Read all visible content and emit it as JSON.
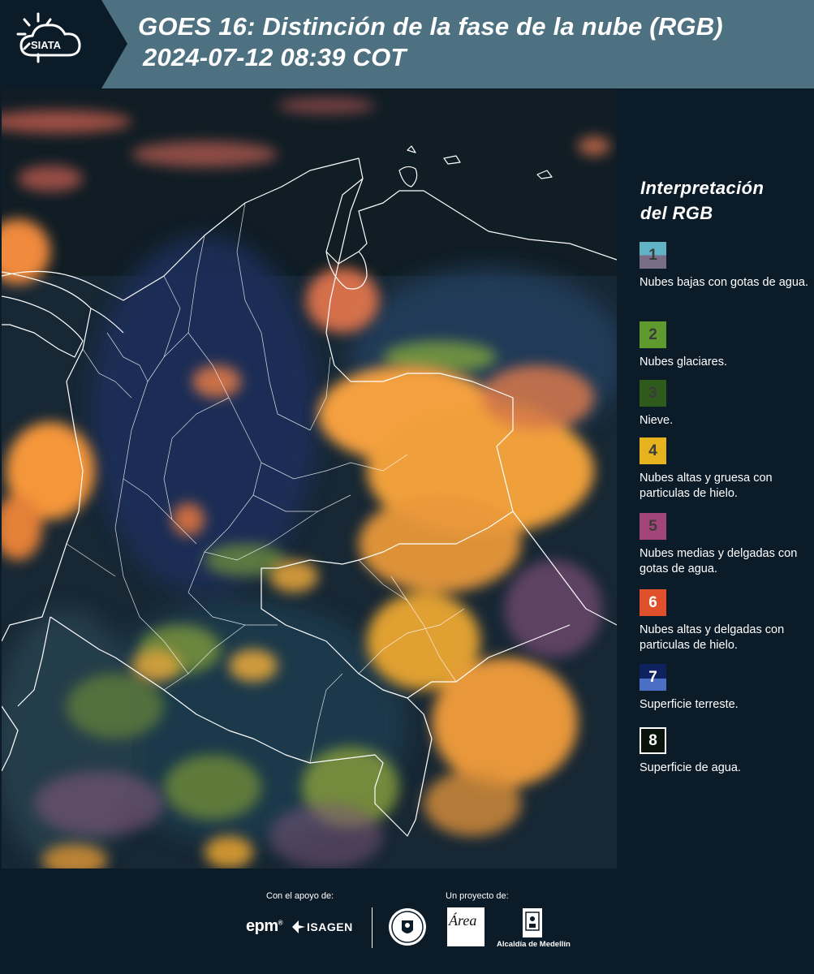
{
  "header": {
    "logo_text": "SIATA",
    "title_line1": "GOES 16: Distinción de la fase de la nube (RGB)",
    "title_line2": "2024-07-12 08:39 COT"
  },
  "legend": {
    "title_line1": "Interpretación",
    "title_line2": "del RGB",
    "items": [
      {
        "number": "1",
        "label": "Nubes bajas con gotas de agua.",
        "color_top": "#5fb3c4",
        "color_bottom": "#7a6d86"
      },
      {
        "number": "2",
        "label": "Nubes glaciares.",
        "color_top": "#5e9a2e",
        "color_bottom": "#5e9a2e"
      },
      {
        "number": "3",
        "label": "Nieve.",
        "color_top": "#2e5a1c",
        "color_bottom": "#2e5a1c"
      },
      {
        "number": "4",
        "label": "Nubes altas y gruesa con particulas de hielo.",
        "color_top": "#e6b21e",
        "color_bottom": "#e6b21e"
      },
      {
        "number": "5",
        "label": "Nubes medias y delgadas con gotas de agua.",
        "color_top": "#a3457a",
        "color_bottom": "#a3457a"
      },
      {
        "number": "6",
        "label": "Nubes altas y delgadas con particulas de hielo.",
        "color_top": "#e0502a",
        "color_bottom": "#e0502a"
      },
      {
        "number": "7",
        "label": "Superficie terreste.",
        "color_top": "#0f2260",
        "color_bottom": "#4b6fc4"
      },
      {
        "number": "8",
        "label": "Superficie de agua.",
        "color_top": "#0a140a",
        "color_bottom": "#0a140a"
      }
    ]
  },
  "footer": {
    "support_label": "Con el apoyo de:",
    "project_label": "Un proyecto de:",
    "sponsor1": "epm",
    "sponsor2": "ISAGEN",
    "partner_area": "Área",
    "partner_alcaldia": "Alcaldía de Medellín"
  }
}
